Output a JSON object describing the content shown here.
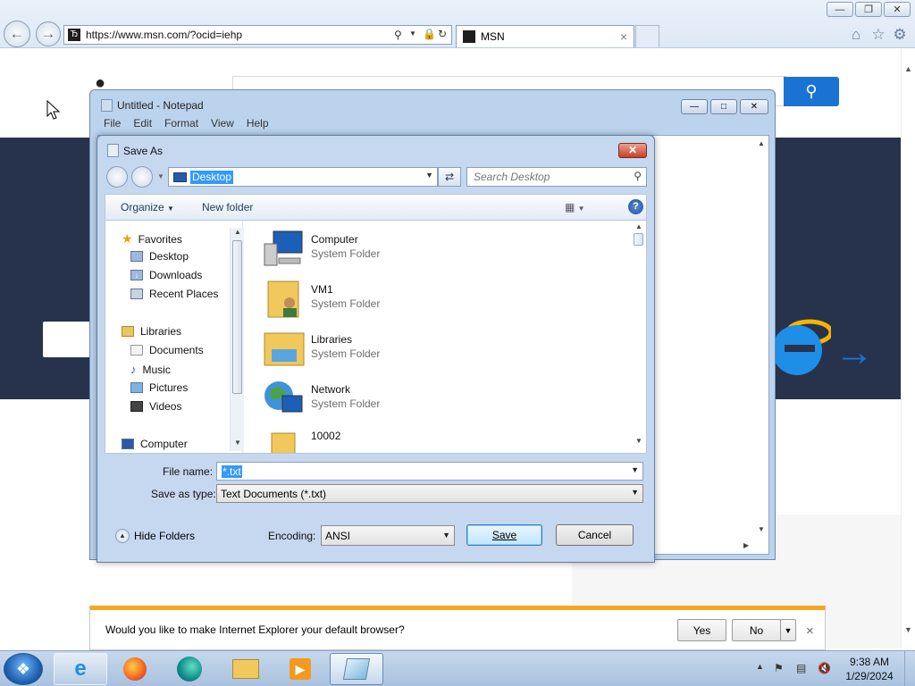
{
  "browser": {
    "url": "https://www.msn.com/?ocid=iehp",
    "tab_title": "MSN",
    "tab_close": "×"
  },
  "notepad": {
    "title": "Untitled - Notepad",
    "menu": [
      "File",
      "Edit",
      "Format",
      "View",
      "Help"
    ]
  },
  "save_as": {
    "title": "Save As",
    "location": "Desktop",
    "search_placeholder": "Search Desktop",
    "toolbar": {
      "organize": "Organize",
      "new_folder": "New folder"
    },
    "nav": {
      "favorites": "Favorites",
      "desktop": "Desktop",
      "downloads": "Downloads",
      "recent_places": "Recent Places",
      "libraries": "Libraries",
      "documents": "Documents",
      "music": "Music",
      "pictures": "Pictures",
      "videos": "Videos",
      "computer": "Computer"
    },
    "files": [
      {
        "name": "Computer",
        "type": "System Folder"
      },
      {
        "name": "VM1",
        "type": "System Folder"
      },
      {
        "name": "Libraries",
        "type": "System Folder"
      },
      {
        "name": "Network",
        "type": "System Folder"
      },
      {
        "name": "10002",
        "type": ""
      }
    ],
    "file_name_label": "File name:",
    "file_name_value": "*.txt",
    "save_as_type_label": "Save as type:",
    "save_as_type_value": "Text Documents (*.txt)",
    "hide_folders": "Hide Folders",
    "encoding_label": "Encoding:",
    "encoding_value": "ANSI",
    "save_button": "Save",
    "cancel_button": "Cancel"
  },
  "notification": {
    "message": "Would you like to make Internet Explorer your default browser?",
    "yes": "Yes",
    "no": "No"
  },
  "taskbar": {
    "time": "9:38 AM",
    "date": "1/29/2024"
  },
  "colors": {
    "msn_band": "#27334d",
    "msn_search_button": "#1a73d3",
    "notification_accent": "#f5a623"
  }
}
